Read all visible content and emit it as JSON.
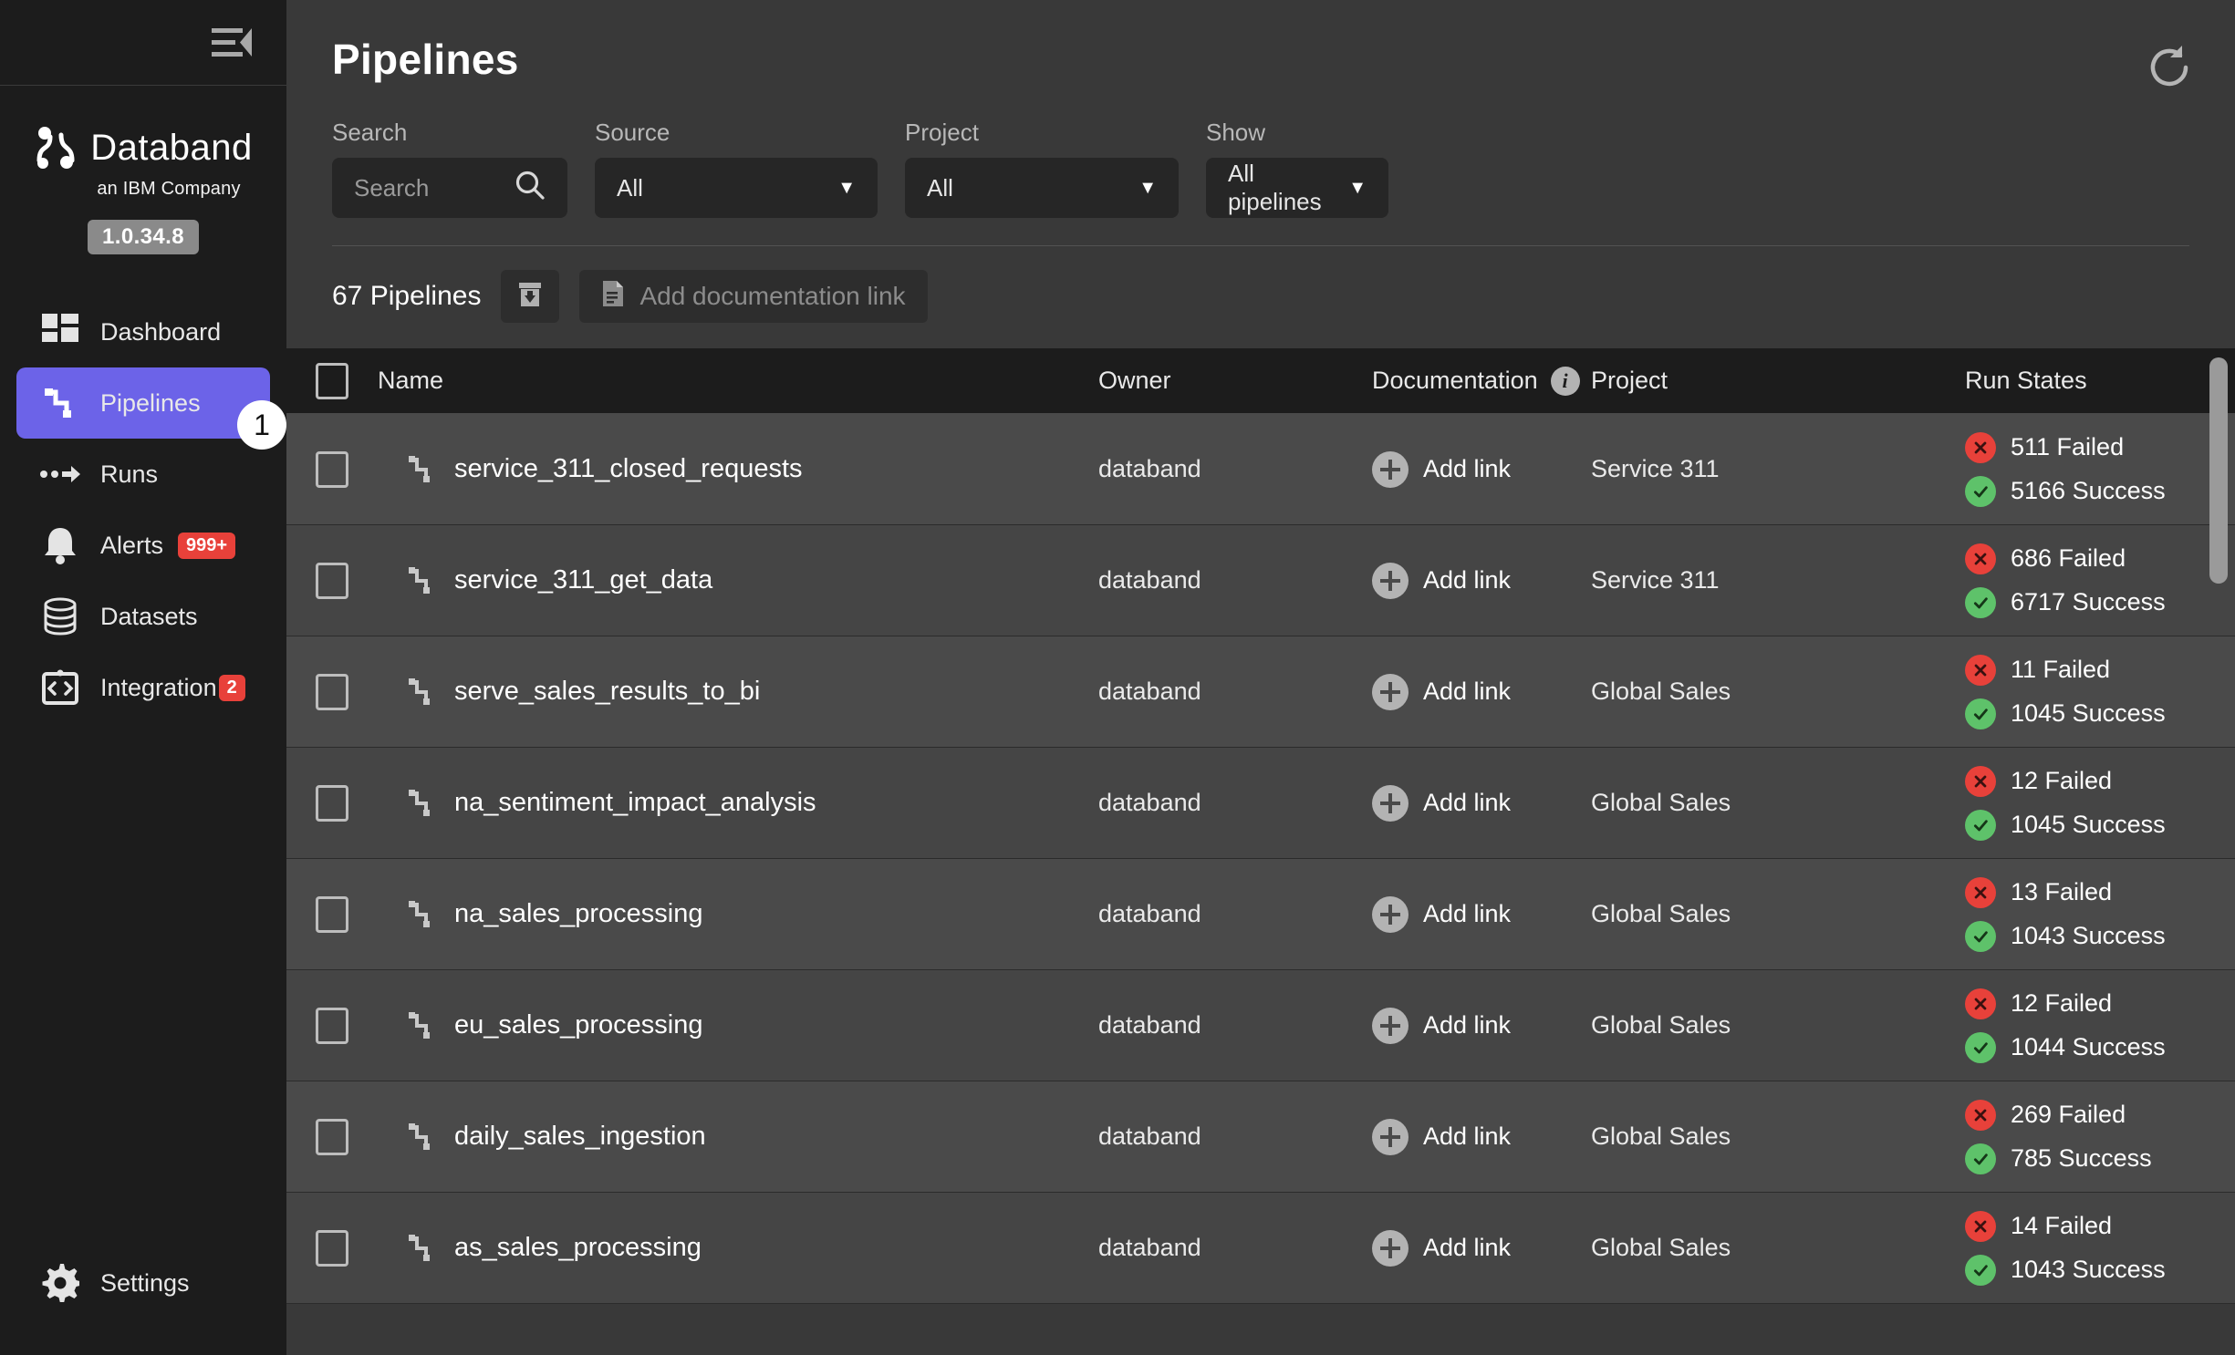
{
  "sidebar": {
    "collapse_icon": "collapse-menu-icon",
    "brand": {
      "name": "Databand",
      "tagline": "an IBM Company",
      "version": "1.0.34.8"
    },
    "items": [
      {
        "label": "Dashboard",
        "icon": "dashboard-icon",
        "badge": null,
        "active": false
      },
      {
        "label": "Pipelines",
        "icon": "pipeline-icon",
        "badge": null,
        "active": true,
        "step": "1"
      },
      {
        "label": "Runs",
        "icon": "runs-icon",
        "badge": null,
        "active": false
      },
      {
        "label": "Alerts",
        "icon": "bell-icon",
        "badge": "999+",
        "active": false
      },
      {
        "label": "Datasets",
        "icon": "database-icon",
        "badge": null,
        "active": false
      },
      {
        "label": "Integration",
        "icon": "code-brackets-icon",
        "badge": "2",
        "active": false
      }
    ],
    "bottom": {
      "label": "Settings",
      "icon": "gear-icon"
    }
  },
  "header": {
    "title": "Pipelines",
    "refresh_icon": "refresh-icon"
  },
  "filters": [
    {
      "label": "Search",
      "type": "search",
      "value": "",
      "placeholder": "Search",
      "icon": "search-icon"
    },
    {
      "label": "Source",
      "type": "select",
      "value": "All"
    },
    {
      "label": "Project",
      "type": "select",
      "value": "All"
    },
    {
      "label": "Show",
      "type": "select",
      "value": "All pipelines"
    }
  ],
  "toolbar": {
    "count": "67 Pipelines",
    "export_icon": "export-archive-icon",
    "add_doc_label": "Add documentation link",
    "add_doc_icon": "document-icon"
  },
  "table": {
    "columns": [
      "Name",
      "Owner",
      "Documentation",
      "Project",
      "Run States"
    ],
    "documentation_info_icon": "info-icon",
    "add_link_label": "Add link",
    "rows": [
      {
        "name": "service_311_closed_requests",
        "owner": "databand",
        "documentation": "Add link",
        "project": "Service 311",
        "failed": "511 Failed",
        "success": "5166 Success"
      },
      {
        "name": "service_311_get_data",
        "owner": "databand",
        "documentation": "Add link",
        "project": "Service 311",
        "failed": "686 Failed",
        "success": "6717 Success"
      },
      {
        "name": "serve_sales_results_to_bi",
        "owner": "databand",
        "documentation": "Add link",
        "project": "Global Sales",
        "failed": "11 Failed",
        "success": "1045 Success"
      },
      {
        "name": "na_sentiment_impact_analysis",
        "owner": "databand",
        "documentation": "Add link",
        "project": "Global Sales",
        "failed": "12 Failed",
        "success": "1045 Success"
      },
      {
        "name": "na_sales_processing",
        "owner": "databand",
        "documentation": "Add link",
        "project": "Global Sales",
        "failed": "13 Failed",
        "success": "1043 Success"
      },
      {
        "name": "eu_sales_processing",
        "owner": "databand",
        "documentation": "Add link",
        "project": "Global Sales",
        "failed": "12 Failed",
        "success": "1044 Success"
      },
      {
        "name": "daily_sales_ingestion",
        "owner": "databand",
        "documentation": "Add link",
        "project": "Global Sales",
        "failed": "269 Failed",
        "success": "785 Success"
      },
      {
        "name": "as_sales_processing",
        "owner": "databand",
        "documentation": "Add link",
        "project": "Global Sales",
        "failed": "14 Failed",
        "success": "1043 Success"
      }
    ]
  },
  "colors": {
    "accent": "#6c63e8",
    "failed": "#e8413a",
    "success": "#5ec26a",
    "sidebar_bg": "#1c1c1c",
    "main_bg": "#393939",
    "row_bg": "#4a4a4a"
  }
}
